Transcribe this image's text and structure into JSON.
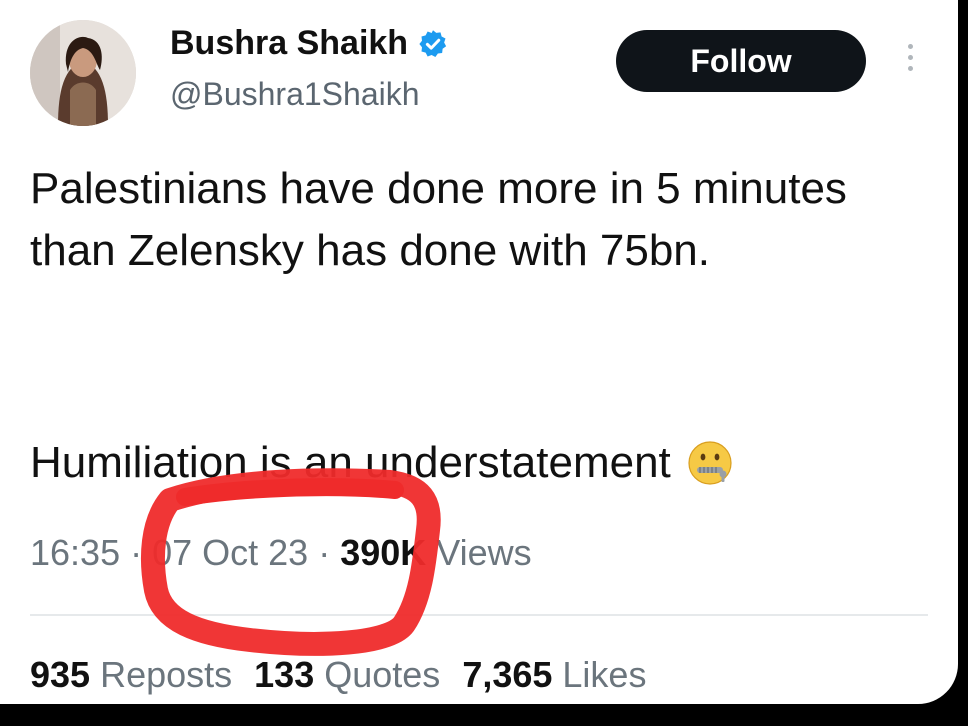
{
  "author": {
    "name": "Bushra Shaikh",
    "handle": "@Bushra1Shaikh",
    "verified": true,
    "verified_icon": "verified-badge-icon",
    "avatar_icon": "avatar"
  },
  "actions": {
    "follow_label": "Follow",
    "more_icon": "more-vertical-icon"
  },
  "tweet": {
    "text_para1": "Palestinians have done more in 5 minutes than Zelensky has done with 75bn.",
    "text_para2": "Humiliation is an understatement",
    "emoji_icon": "zipper-mouth-face-icon"
  },
  "meta": {
    "time": "16:35",
    "separator": "·",
    "date": "07 Oct 23",
    "views_count": "390K",
    "views_label": "Views"
  },
  "stats": [
    {
      "count": "935",
      "label": "Reposts"
    },
    {
      "count": "133",
      "label": "Quotes"
    },
    {
      "count": "7,365",
      "label": "Likes"
    }
  ],
  "colors": {
    "scribble": "#ef2b2b",
    "verified": "#1d9bf0",
    "button_bg": "#0f1419"
  }
}
